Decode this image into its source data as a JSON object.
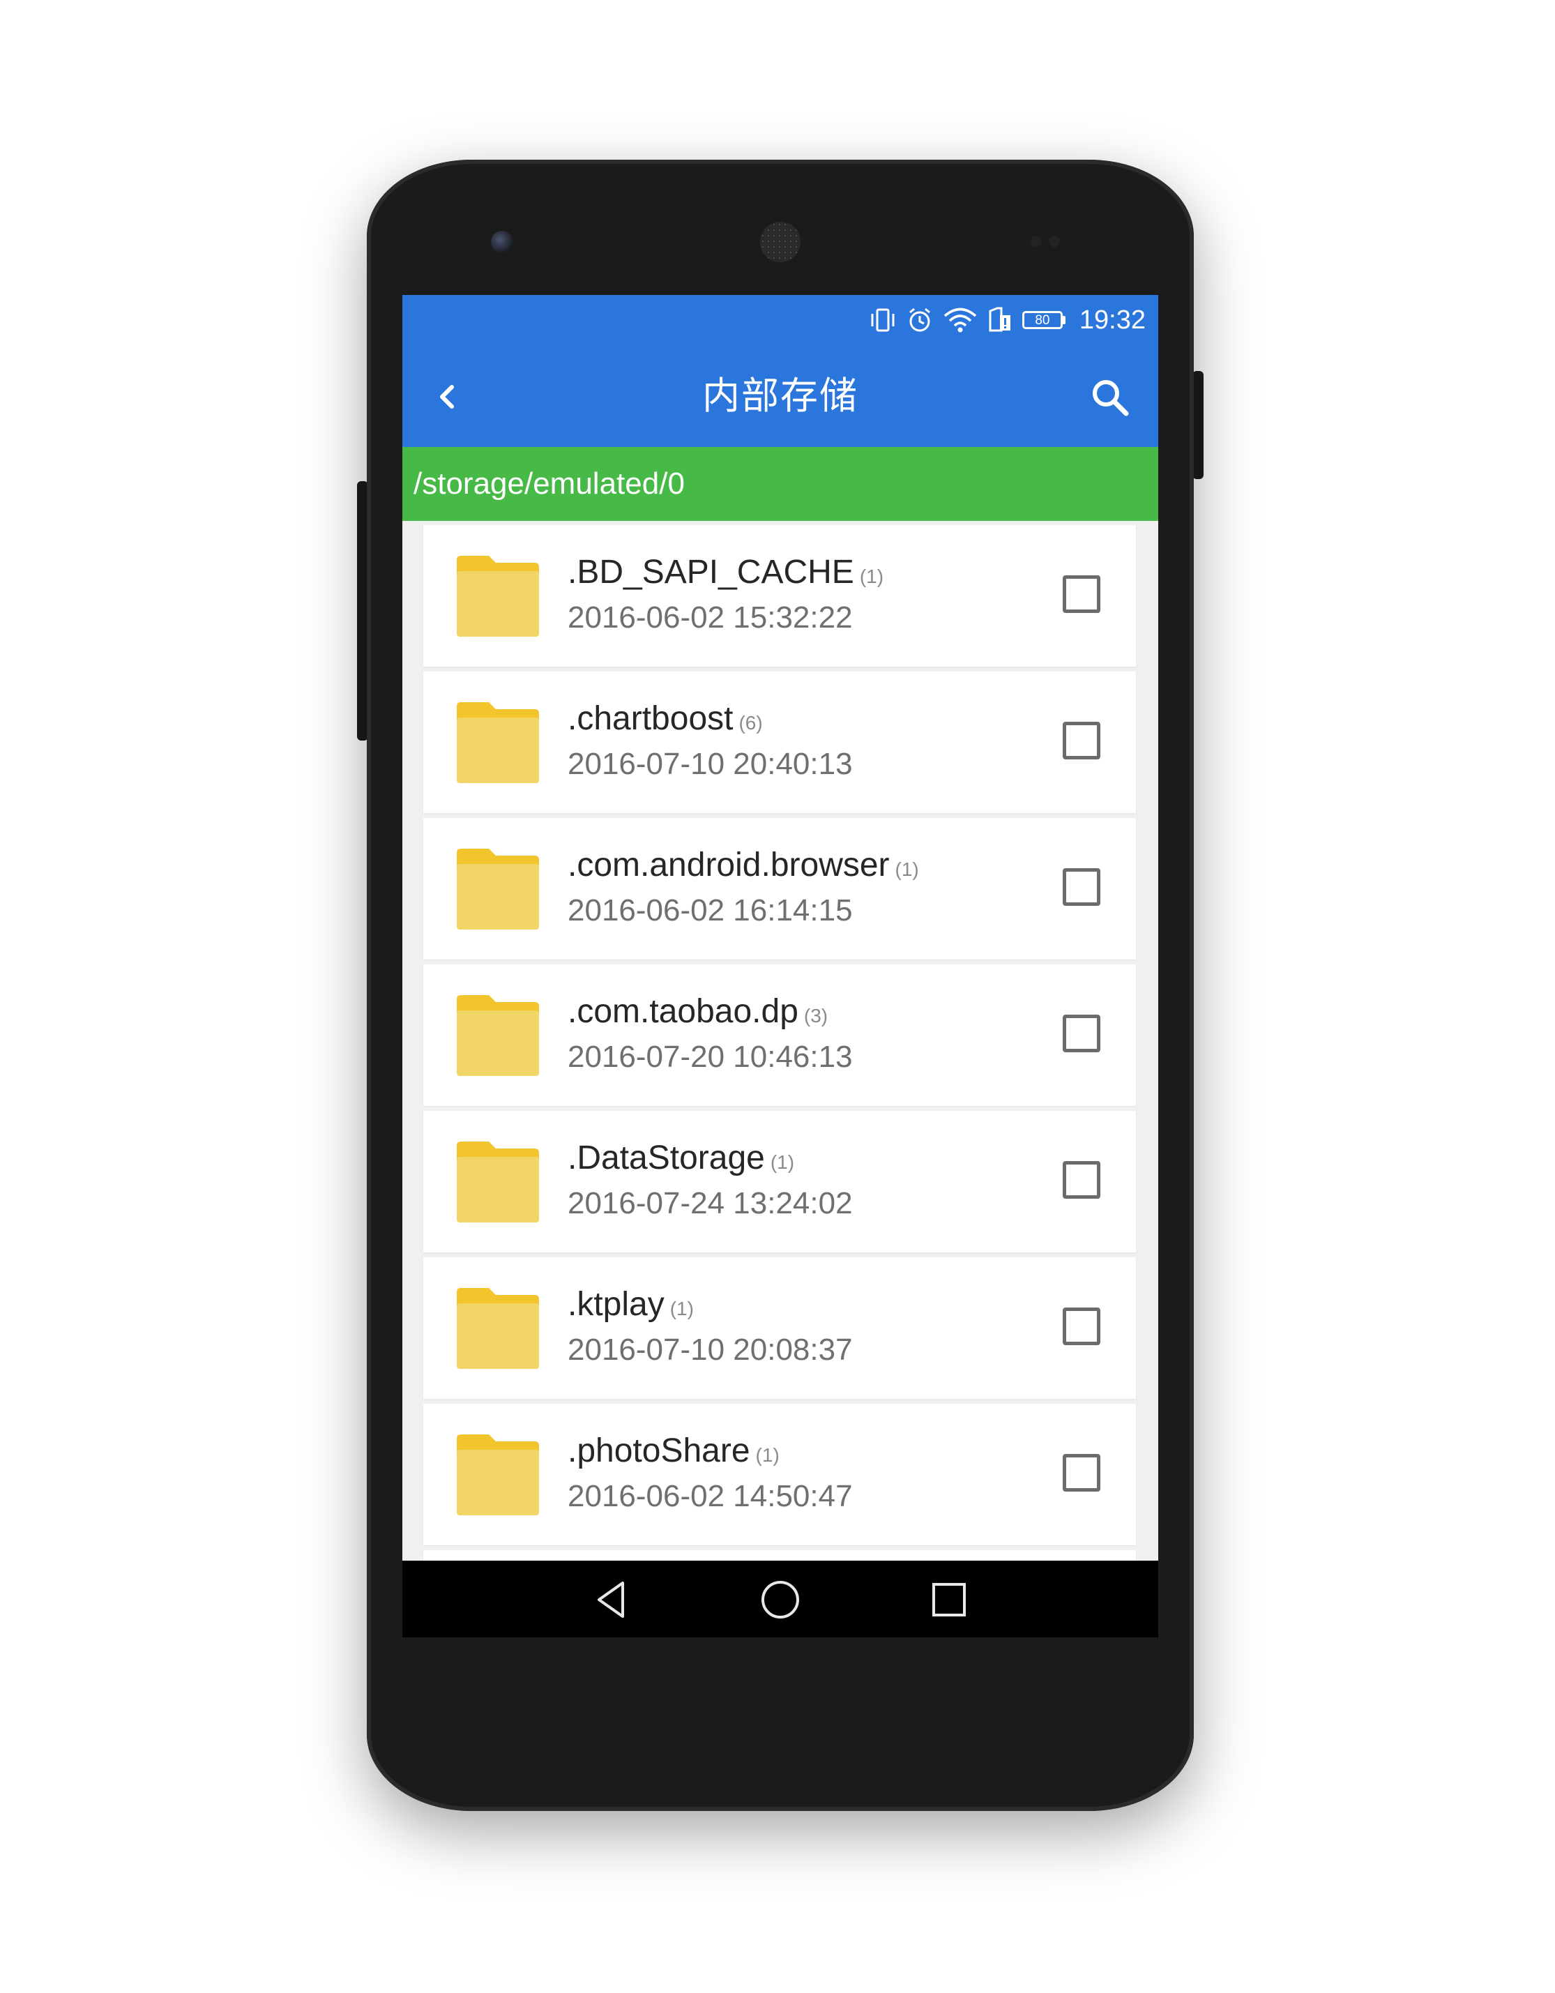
{
  "status_bar": {
    "icons": [
      "vibrate-icon",
      "alarm-icon",
      "wifi-icon",
      "sim-icon"
    ],
    "battery_level": "80",
    "time": "19:32"
  },
  "app_bar": {
    "back_icon": "chevron-left-icon",
    "title": "内部存储",
    "search_icon": "search-icon"
  },
  "path": "/storage/emulated/0",
  "colors": {
    "primary": "#2b76dc",
    "path_bar": "#46b946",
    "folder": "#f2d567",
    "folder_tab": "#f1c52b"
  },
  "files": [
    {
      "name": ".BD_SAPI_CACHE",
      "count": "(1)",
      "date": "2016-06-02 15:32:22",
      "checked": false
    },
    {
      "name": ".chartboost",
      "count": "(6)",
      "date": "2016-07-10 20:40:13",
      "checked": false
    },
    {
      "name": ".com.android.browser",
      "count": "(1)",
      "date": "2016-06-02 16:14:15",
      "checked": false
    },
    {
      "name": ".com.taobao.dp",
      "count": "(3)",
      "date": "2016-07-20 10:46:13",
      "checked": false
    },
    {
      "name": ".DataStorage",
      "count": "(1)",
      "date": "2016-07-24 13:24:02",
      "checked": false
    },
    {
      "name": ".ktplay",
      "count": "(1)",
      "date": "2016-07-10 20:08:37",
      "checked": false
    },
    {
      "name": ".photoShare",
      "count": "(1)",
      "date": "2016-06-02 14:50:47",
      "checked": false
    }
  ],
  "nav_bar": {
    "back": "nav-back-icon",
    "home": "nav-home-icon",
    "recents": "nav-recents-icon"
  }
}
